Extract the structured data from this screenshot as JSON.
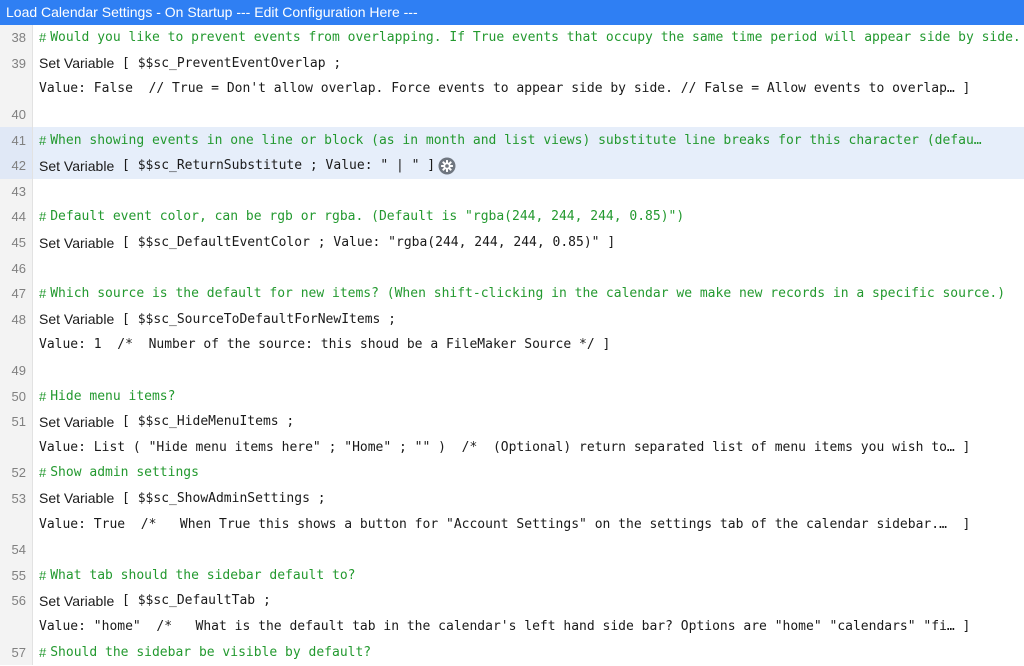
{
  "window": {
    "title": "Load Calendar Settings - On Startup --- Edit Configuration Here ---"
  },
  "lines": [
    {
      "num": "38",
      "kind": "comment",
      "text": "Would you like to prevent events from overlapping. If True events that occupy the same time period will appear side by side."
    },
    {
      "num": "39",
      "kind": "code",
      "kw": "Set Variable",
      "rest": " [ $$sc_PreventEventOverlap ;"
    },
    {
      "num": "",
      "kind": "cont",
      "text": "Value: False  // True = Don't allow overlap. Force events to appear side by side. // False = Allow events to overlap… ]"
    },
    {
      "num": "40",
      "kind": "blank"
    },
    {
      "num": "41",
      "kind": "comment",
      "text": "When showing events in one line or block (as in month and list views) substitute line breaks for this character (defau…",
      "selected": true
    },
    {
      "num": "42",
      "kind": "code",
      "kw": "Set Variable",
      "rest": " [ $$sc_ReturnSubstitute ; Value: \" | \" ]",
      "selected": true,
      "gear": true
    },
    {
      "num": "43",
      "kind": "blank"
    },
    {
      "num": "44",
      "kind": "comment",
      "text": "Default event color, can be rgb or rgba. (Default is \"rgba(244, 244, 244, 0.85)\")"
    },
    {
      "num": "45",
      "kind": "code",
      "kw": "Set Variable",
      "rest": " [ $$sc_DefaultEventColor ; Value: \"rgba(244, 244, 244, 0.85)\" ]"
    },
    {
      "num": "46",
      "kind": "blank"
    },
    {
      "num": "47",
      "kind": "comment",
      "text": "Which source is the default for new items? (When shift-clicking in the calendar we make new records in a specific source.)"
    },
    {
      "num": "48",
      "kind": "code",
      "kw": "Set Variable",
      "rest": " [ $$sc_SourceToDefaultForNewItems ;"
    },
    {
      "num": "",
      "kind": "cont",
      "text": "Value: 1  /*  Number of the source: this shoud be a FileMaker Source */ ]"
    },
    {
      "num": "49",
      "kind": "blank"
    },
    {
      "num": "50",
      "kind": "comment",
      "text": "Hide menu items?"
    },
    {
      "num": "51",
      "kind": "code",
      "kw": "Set Variable",
      "rest": " [ $$sc_HideMenuItems ;"
    },
    {
      "num": "",
      "kind": "cont",
      "text": "Value: List ( \"Hide menu items here\" ; \"Home\" ; \"\" )  /*  (Optional) return separated list of menu items you wish to… ]"
    },
    {
      "num": "52",
      "kind": "comment",
      "text": "Show admin settings"
    },
    {
      "num": "53",
      "kind": "code",
      "kw": "Set Variable",
      "rest": " [ $$sc_ShowAdminSettings ;"
    },
    {
      "num": "",
      "kind": "cont",
      "text": "Value: True  /*   When True this shows a button for \"Account Settings\" on the settings tab of the calendar sidebar.…  ]"
    },
    {
      "num": "54",
      "kind": "blank"
    },
    {
      "num": "55",
      "kind": "comment",
      "text": "What tab should the sidebar default to?"
    },
    {
      "num": "56",
      "kind": "code",
      "kw": "Set Variable",
      "rest": " [ $$sc_DefaultTab ;"
    },
    {
      "num": "",
      "kind": "cont",
      "text": "Value: \"home\"  /*   What is the default tab in the calendar's left hand side bar? Options are \"home\" \"calendars\" \"fi… ]"
    },
    {
      "num": "57",
      "kind": "comment",
      "text": "Should the sidebar be visible by default?"
    }
  ],
  "colors": {
    "titlebar": "#2f7ff3",
    "comment": "#23992f",
    "selected": "#e6eefa"
  }
}
